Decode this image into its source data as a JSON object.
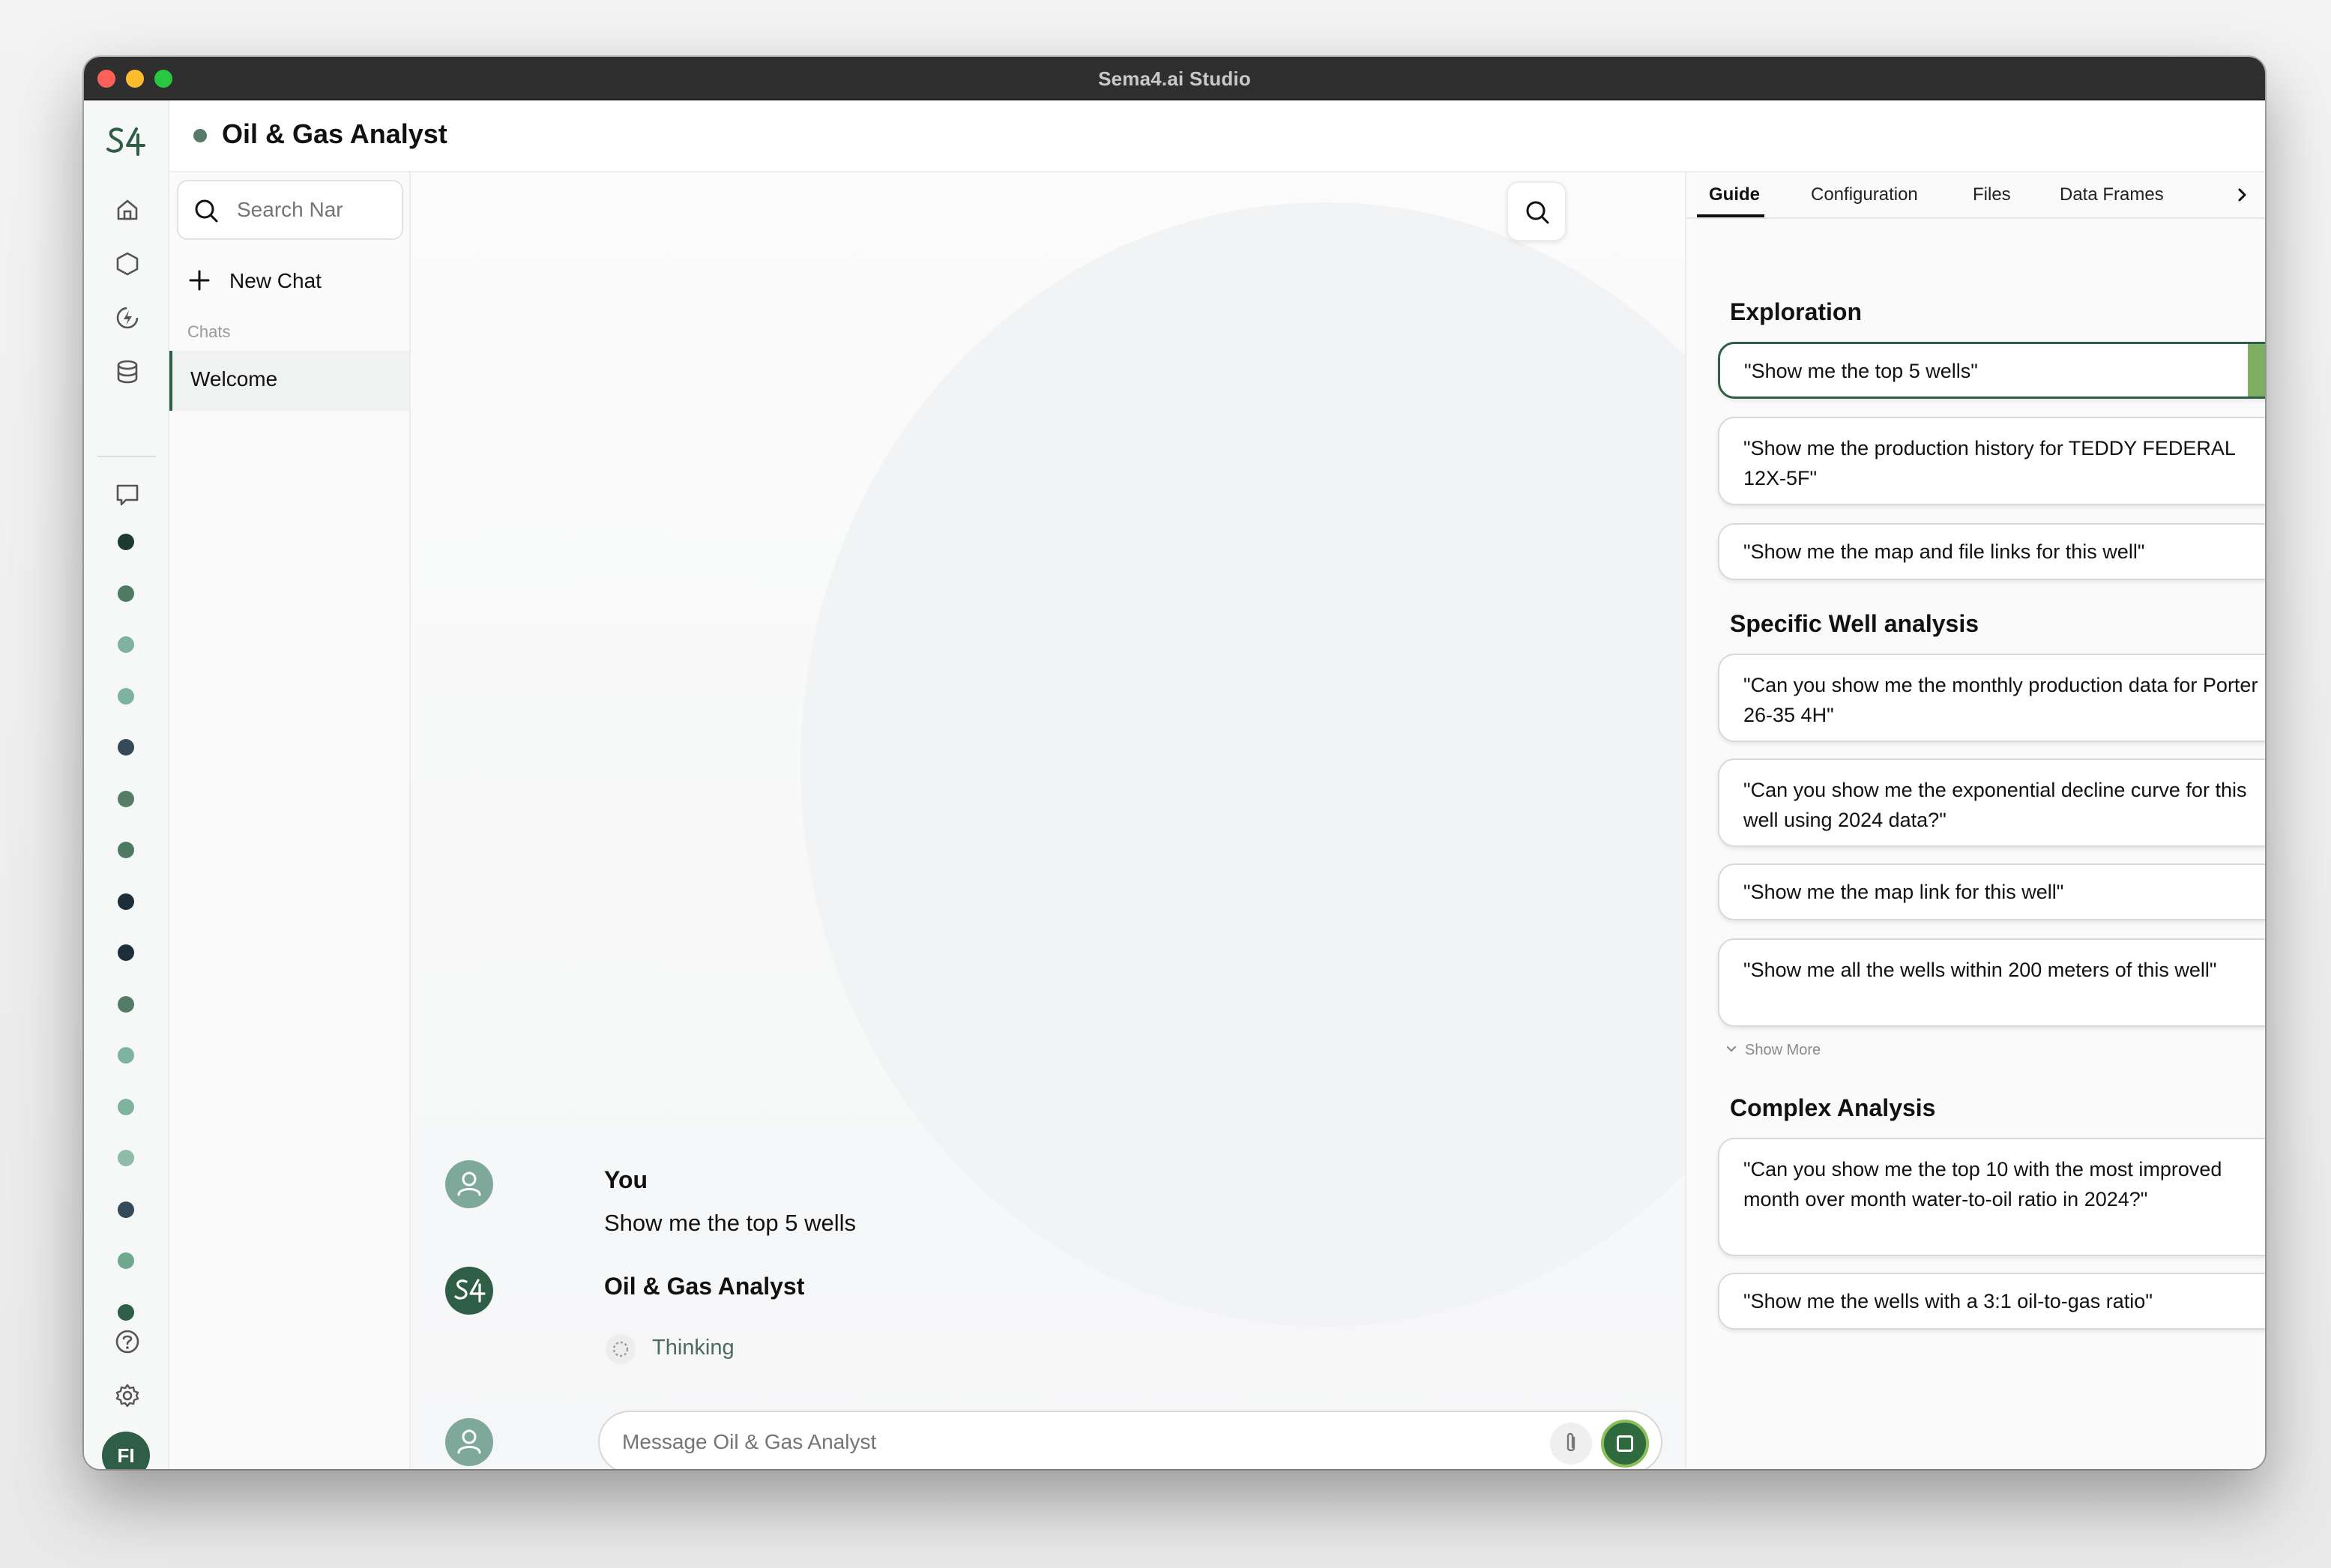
{
  "window": {
    "title": "Sema4.ai Studio"
  },
  "header": {
    "agent_name": "Oil & Gas Analyst",
    "status_color": "#5a7a69"
  },
  "rail": {
    "logo_text": "S4",
    "icons": [
      "home-icon",
      "cube-icon",
      "lightning-icon",
      "database-icon",
      "chat-icon"
    ],
    "agent_dots": [
      "#1f3b2f",
      "#4e7a62",
      "#7fb3a0",
      "#7fb3a0",
      "#34495a",
      "#557d66",
      "#4e7a62",
      "#1c2e3a",
      "#1c2e3a",
      "#557d66",
      "#7fb3a0",
      "#7fb3a0",
      "#8fbcaa",
      "#34495a",
      "#6fa88f",
      "#2f5e46"
    ],
    "bottom_icons": [
      "help-icon",
      "settings-icon"
    ],
    "user_initials": "FI"
  },
  "chats": {
    "search_placeholder": "Search Nar",
    "new_chat_label": "New Chat",
    "section_label": "Chats",
    "items": [
      {
        "label": "Welcome",
        "active": true
      }
    ]
  },
  "conversation": {
    "messages": [
      {
        "author": "You",
        "text": "Show me the top 5 wells"
      },
      {
        "author": "Oil & Gas Analyst",
        "status": "Thinking"
      }
    ],
    "composer_placeholder": "Message Oil & Gas Analyst"
  },
  "panel": {
    "tabs": [
      "Guide",
      "Configuration",
      "Files",
      "Data Frames"
    ],
    "active_tab": "Guide",
    "sections": [
      {
        "title": "Exploration",
        "prompts": [
          "\"Show me the top 5 wells\"",
          "\"Show me the production history for TEDDY FEDERAL 12X-5F\"",
          "\"Show me the map and file links for this well\""
        ]
      },
      {
        "title": "Specific Well analysis",
        "prompts": [
          "\"Can you show me the monthly production data for Porter 26-35 4H\"",
          "\"Can you show me the exponential decline curve for this well using 2024 data?\"",
          "\"Show me the map link for this well\"",
          "\"Show me all the wells within 200 meters of this well\""
        ],
        "show_more_label": "Show More"
      },
      {
        "title": "Complex Analysis",
        "prompts": [
          "\"Can you show me the top 10 with the most improved month over month water-to-oil ratio in 2024?\"",
          "\"Show me the wells with a 3:1 oil-to-gas ratio\""
        ]
      }
    ],
    "accent_color": "#2f5e46",
    "running_color": "#7fae62"
  }
}
